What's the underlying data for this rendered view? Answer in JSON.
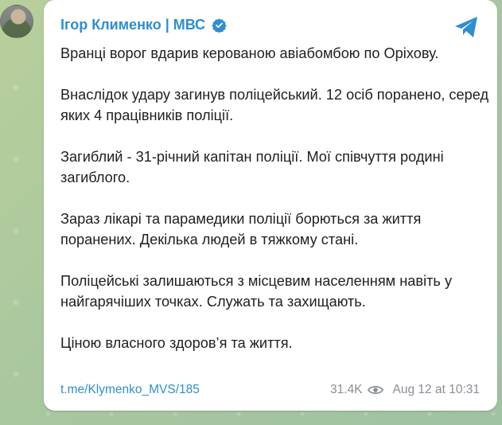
{
  "message": {
    "author": "Ігор Клименко | МВС",
    "paragraphs": [
      "Вранці ворог вдарив керованою авіабомбою по Оріхову.",
      "Внаслідок удару загинув поліцейський. 12 осіб поранено, серед яких 4 працівників поліції.",
      "Загиблий - 31-річний капітан поліції. Мої співчуття родині загиблого.",
      "Зараз лікарі та парамедики поліції борються за життя поранених. Декілька людей в тяжкому стані.",
      "Поліцейські залишаються з місцевим населенням навіть у найгарячіших точках. Служать та захищають.",
      "Ціною власного здоров’я та життя."
    ],
    "link": "t.me/Klymenko_MVS/185",
    "views": "31.4K",
    "date": "Aug 12 at 10:31"
  },
  "colors": {
    "accent": "#2f8ed0",
    "meta": "#8a8f96"
  },
  "icons": {
    "verified": "verified-badge-icon",
    "telegram": "telegram-send-icon",
    "views": "eye-icon"
  }
}
